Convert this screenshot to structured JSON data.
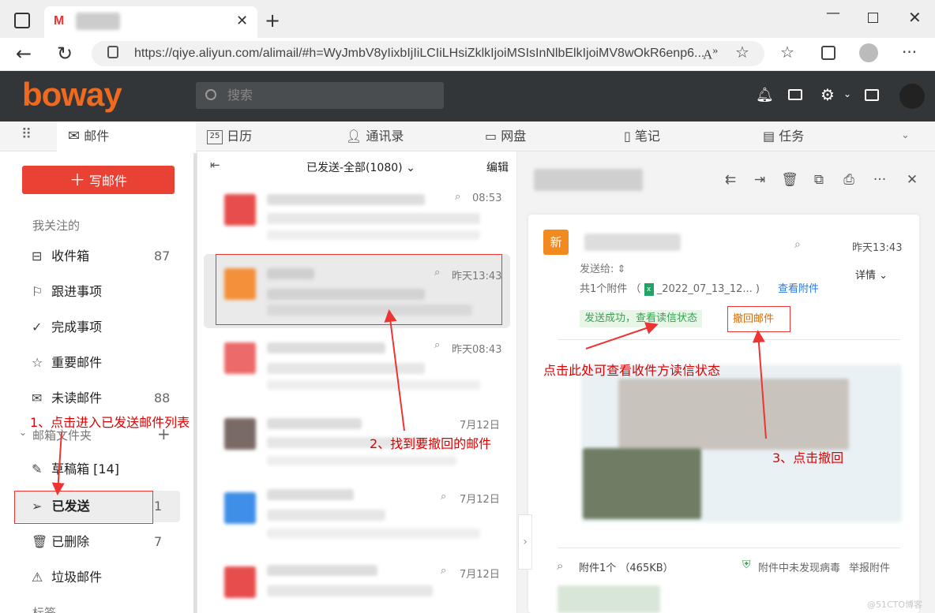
{
  "browser": {
    "url": "https://qiye.aliyun.com/alimail/#h=WyJmbV8yIixbIjIiLCIiLHsiZklkIjoiMSIsInNlbElkIjoiMV8wOkR6enp6..."
  },
  "header": {
    "logo": "boway",
    "search_placeholder": "搜索"
  },
  "nav": [
    "邮件",
    "日历",
    "通讯录",
    "网盘",
    "笔记",
    "任务"
  ],
  "sidebar": {
    "compose": "写邮件",
    "focus_heading": "我关注的",
    "items": [
      {
        "label": "收件箱",
        "count": "87"
      },
      {
        "label": "跟进事项",
        "count": ""
      },
      {
        "label": "完成事项",
        "count": ""
      },
      {
        "label": "重要邮件",
        "count": ""
      },
      {
        "label": "未读邮件",
        "count": "88"
      }
    ],
    "folders_heading": "邮箱文件夹",
    "folders": [
      {
        "label": "草稿箱 [14]",
        "count": ""
      },
      {
        "label": "已发送",
        "count": "1"
      },
      {
        "label": "已删除",
        "count": "7"
      },
      {
        "label": "垃圾邮件",
        "count": ""
      }
    ],
    "tags_heading": "标签"
  },
  "list": {
    "title": "已发送-全部(1080)",
    "edit": "编辑",
    "times": [
      "08:53",
      "昨天13:43",
      "昨天08:43",
      "7月12日",
      "7月12日",
      "7月12日"
    ]
  },
  "reader": {
    "avatar": "新",
    "time": "昨天13:43",
    "sent_to": "发送给:",
    "attach_count": "共1个附件",
    "attach_name": "_2022_07_13_12... )",
    "view_attach": "查看附件",
    "details": "详情",
    "status": "发送成功，查看读信状态",
    "recall": "撤回邮件",
    "attach_footer": "附件1个 （465KB）",
    "virus_ok": "附件中未发现病毒",
    "report": "举报附件"
  },
  "annotations": {
    "step1": "1、点击进入已发送邮件列表",
    "step2": "2、找到要撤回的邮件",
    "step3": "3、点击撤回",
    "read_status": "点击此处可查看收件方读信状态"
  },
  "watermark": "@51CTO博客"
}
